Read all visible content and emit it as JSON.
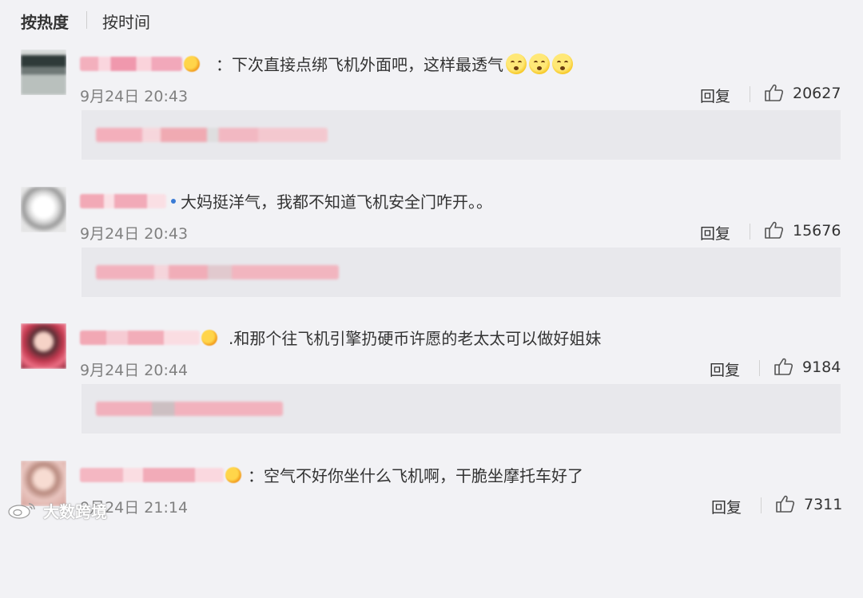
{
  "sort_tabs": {
    "hot": "按热度",
    "time": "按时间"
  },
  "actions": {
    "reply": "回复"
  },
  "comments": [
    {
      "text": "：下次直接点绑飞机外面吧，这样最透气",
      "emoji_count": 3,
      "time": "9月24日 20:43",
      "likes": "20627"
    },
    {
      "text": "大妈挺洋气，我都不知道飞机安全门咋开。。",
      "emoji_count": 0,
      "time": "9月24日 20:43",
      "likes": "15676"
    },
    {
      "text": "和那个往飞机引擎扔硬币许愿的老太太可以做好姐妹",
      "emoji_count": 0,
      "time": "9月24日 20:44",
      "likes": "9184"
    },
    {
      "text": "：空气不好你坐什么飞机啊，干脆坐摩托车好了",
      "emoji_count": 0,
      "time": "9月24日 21:14",
      "likes": "7311"
    }
  ],
  "watermark": {
    "text": "大数跨境",
    "logo": "weibo-logo-icon"
  },
  "colors": {
    "background": "#f2f2f5",
    "reply_box": "#e8e8ec",
    "text": "#333333",
    "meta": "#808080"
  }
}
